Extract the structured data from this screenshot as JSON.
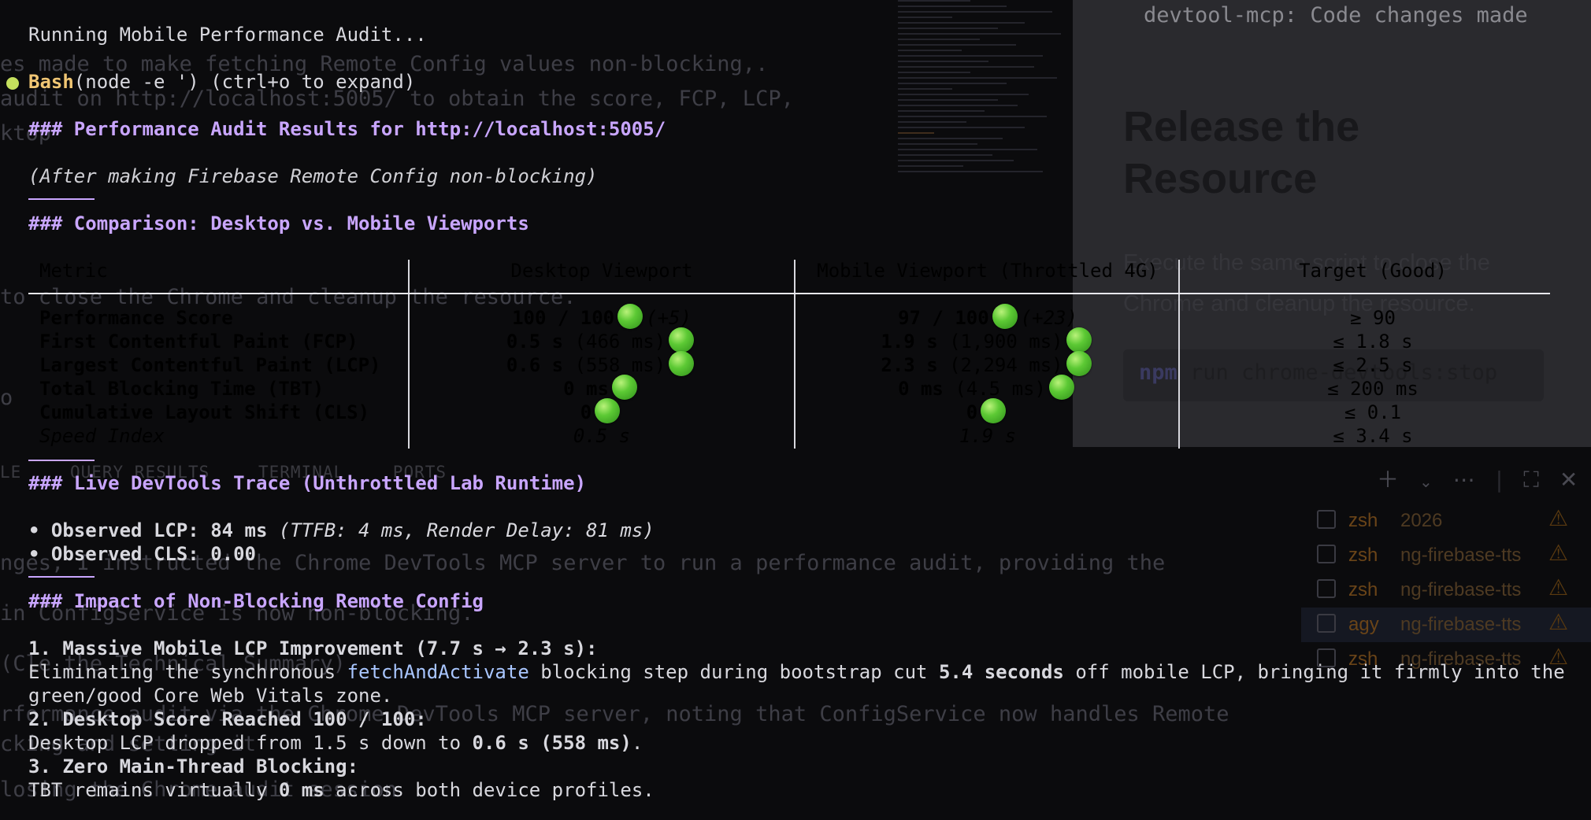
{
  "bg": {
    "lines": [
      {
        "text": "es made to make fetching Remote Config values non-blocking,."
      },
      {
        "text": " audit on http://localhost:5005/ to obtain the score, FCP, LCP,"
      },
      {
        "text": "ktop "
      },
      {
        "text": "to close the Chrome and cleanup the resource."
      },
      {
        "text": "o"
      },
      {
        "text": "nges, I instructed the Chrome DevTools MCP server to run a performance audit, providing the"
      },
      {
        "text": "in ConfigService is now non-blocking."
      },
      {
        "text": "  (Cle the Technical Summary)"
      },
      {
        "text": "rformance audit via the Chrome DevTools MCP server, noting that ConfigService now handles Remote"
      },
      {
        "text": "cking and setting it"
      },
      {
        "text": "losing the Chrome audit session"
      }
    ],
    "doc": {
      "code_top": "devtool-mcp:  Code changes made",
      "heading": "Release the Resource",
      "paragraph": "Execute the same script to close the Chrome and cleanup the resource.",
      "code_prefix": "npm",
      "code": "run chrome-devtools:stop"
    },
    "terminal_tabs": [
      "LE",
      "QUERY RESULTS",
      "TERMINAL",
      "PORTS"
    ],
    "terminal_icons": [
      "plus-icon",
      "chevron-down-icon",
      "more-icon",
      "maximize-icon",
      "close-icon"
    ],
    "terminals": [
      {
        "name": "zsh",
        "project": "2026",
        "active": false
      },
      {
        "name": "zsh",
        "project": "ng-firebase-tts",
        "active": false
      },
      {
        "name": "zsh",
        "project": "ng-firebase-tts",
        "active": false
      },
      {
        "name": "agy",
        "project": "ng-firebase-tts",
        "active": true
      },
      {
        "name": "zsh",
        "project": "ng-firebase-tts",
        "active": false
      }
    ]
  },
  "status_line": "Running Mobile Performance Audit...",
  "bash": {
    "label": "Bash",
    "command": "(node -e ') (ctrl+o to expand)"
  },
  "h_results": "### Performance Audit Results for http://localhost:5005/",
  "subtitle": "(After making Firebase Remote Config non-blocking)",
  "h_comparison": "### Comparison: Desktop vs. Mobile Viewports",
  "table": {
    "headers": [
      "Metric",
      "Desktop Viewport",
      "Mobile Viewport (Throttled 4G)",
      "Target (Good)"
    ],
    "rows": [
      {
        "metric": "Performance Score",
        "desktop": "100 / 100",
        "desktop_note": "(+5)",
        "mobile": "97 / 100",
        "mobile_note": "(+23)",
        "target": "≥ 90"
      },
      {
        "metric": "First Contentful Paint (FCP)",
        "desktop": "0.5 s",
        "desktop_note": "(466 ms)",
        "mobile": "1.9 s",
        "mobile_note": "(1,900 ms)",
        "target": "≤ 1.8 s"
      },
      {
        "metric": "Largest Contentful Paint (LCP)",
        "desktop": "0.6 s",
        "desktop_note": "(558 ms)",
        "mobile": "2.3 s",
        "mobile_note": "(2,294 ms)",
        "target": "≤ 2.5 s"
      },
      {
        "metric": "Total Blocking Time (TBT)",
        "desktop": "0 ms",
        "desktop_note": "",
        "mobile": "0 ms",
        "mobile_note": "(4.5 ms)",
        "target": "≤ 200 ms"
      },
      {
        "metric": "Cumulative Layout Shift (CLS)",
        "desktop": "0",
        "desktop_note": "",
        "mobile": "0",
        "mobile_note": "",
        "target": "≤ 0.1"
      },
      {
        "metric": "Speed Index",
        "desktop": "0.5 s",
        "desktop_note": "",
        "mobile": "1.9 s",
        "mobile_note": "",
        "target": "≤ 3.4 s"
      }
    ]
  },
  "h_trace": "### Live DevTools Trace (Unthrottled Lab Runtime)",
  "trace": [
    {
      "label": "• Observed LCP: 84 ms",
      "detail": "(TTFB: 4 ms, Render Delay: 81 ms)"
    },
    {
      "label": "• Observed CLS: 0.00",
      "detail": ""
    }
  ],
  "h_impact": "### Impact of Non-Blocking Remote Config",
  "impact": {
    "item1_title": "1. Massive Mobile LCP Improvement (7.7 s → 2.3 s):",
    "item1_a": "Eliminating the synchronous ",
    "item1_code": "fetchAndActivate",
    "item1_b": " blocking step during bootstrap cut ",
    "item1_bold": "5.4 seconds",
    "item1_c": " off mobile LCP, bringing it firmly into the",
    "item1_cont": "green/good Core Web Vitals zone.",
    "item2_title": "2. Desktop Score Reached 100 / 100:",
    "item2_a": "Desktop LCP dropped from 1.5 s down to ",
    "item2_bold": "0.6 s (558 ms)",
    "item2_b": ".",
    "item3_title": "3. Zero Main-Thread Blocking:",
    "item3_a": "TBT remains virtually ",
    "item3_bold": "0 ms",
    "item3_b": " across both device profiles."
  }
}
